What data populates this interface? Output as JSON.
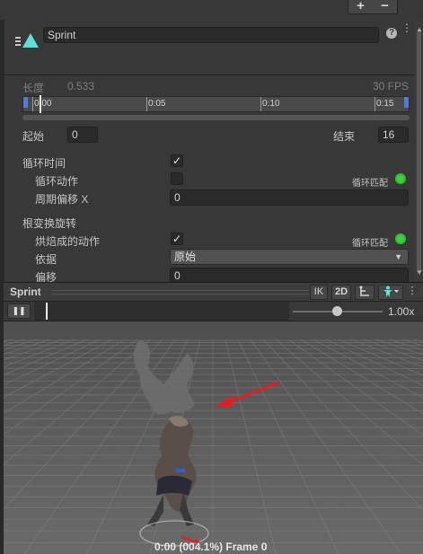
{
  "window": {
    "top_buttons": {
      "plus": "+",
      "minus": "−"
    }
  },
  "clip": {
    "name": "Sprint",
    "help_icon": "?",
    "menu_icon": "⋮"
  },
  "length": {
    "label": "长度",
    "value": "0.533",
    "fps": "30 FPS"
  },
  "timeline": {
    "ticks": [
      "0:00",
      "0:05",
      "0:10",
      "0:15"
    ]
  },
  "range": {
    "start_label": "起始",
    "start_value": "0",
    "end_label": "结束",
    "end_value": "16"
  },
  "loop_time": {
    "label": "循环时间",
    "checked": true
  },
  "loop_pose": {
    "label": "循环动作",
    "checked": false,
    "match_label": "循环匹配",
    "match_color": "#3ad33a"
  },
  "cycle_offset": {
    "label": "周期偏移 X",
    "value": "0"
  },
  "root_rotation": {
    "section_label": "根变换旋转",
    "bake": {
      "label": "烘焙成的动作",
      "checked": true,
      "match_label": "循环匹配",
      "match_color": "#3ad33a"
    },
    "based_on": {
      "label": "依据",
      "value": "原始"
    },
    "offset": {
      "label": "偏移",
      "value": "0"
    }
  },
  "preview": {
    "title": "Sprint",
    "ik_label": "IK",
    "twod_label": "2D",
    "pivot_icon": "pivot-icon",
    "avatar_icon": "avatar-icon",
    "menu_icon": "⋮",
    "play_icon": "❚❚",
    "speed_value": "1.00x",
    "speed_fraction": 0.5,
    "frame_text": "0:00 (004.1%) Frame 0"
  },
  "colors": {
    "accent_blue": "#4a7ed8",
    "loop_match_green": "#3ad33a",
    "arrow_red": "#e02020",
    "clip_icon_cyan": "#5ee0d8"
  }
}
